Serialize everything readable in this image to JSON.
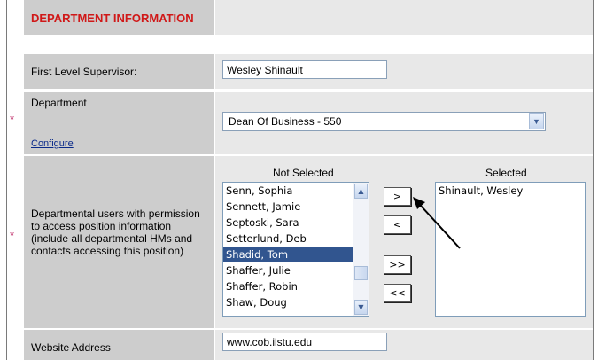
{
  "section": {
    "title": "DEPARTMENT INFORMATION"
  },
  "required_marker": "*",
  "supervisor": {
    "label": "First Level Supervisor:",
    "value": "Wesley Shinault"
  },
  "department": {
    "label": "Department",
    "configure_link": "Configure",
    "selected": "Dean Of Business - 550"
  },
  "users": {
    "label_lines": [
      "Departmental users with permission",
      "to access position information",
      "(include all departmental HMs and",
      "contacts accessing this position)"
    ],
    "not_selected_header": "Not Selected",
    "selected_header": "Selected",
    "not_selected": [
      "Senn, Sophia",
      "Sennett, Jamie",
      "Septoski, Sara",
      "Setterlund, Deb",
      "Shadid, Tom",
      "Shaffer, Julie",
      "Shaffer, Robin",
      "Shaw, Doug"
    ],
    "highlighted_index": 4,
    "selected": [
      "Shinault, Wesley"
    ],
    "buttons": {
      "add": ">",
      "remove": "<",
      "add_all": ">>",
      "remove_all": "<<"
    }
  },
  "website": {
    "label": "Website Address",
    "value": "www.cob.ilstu.edu"
  },
  "colors": {
    "label_bg": "#cdcdcd",
    "value_bg": "#e8e8e8",
    "title_red": "#d01818",
    "highlight": "#31558f"
  }
}
